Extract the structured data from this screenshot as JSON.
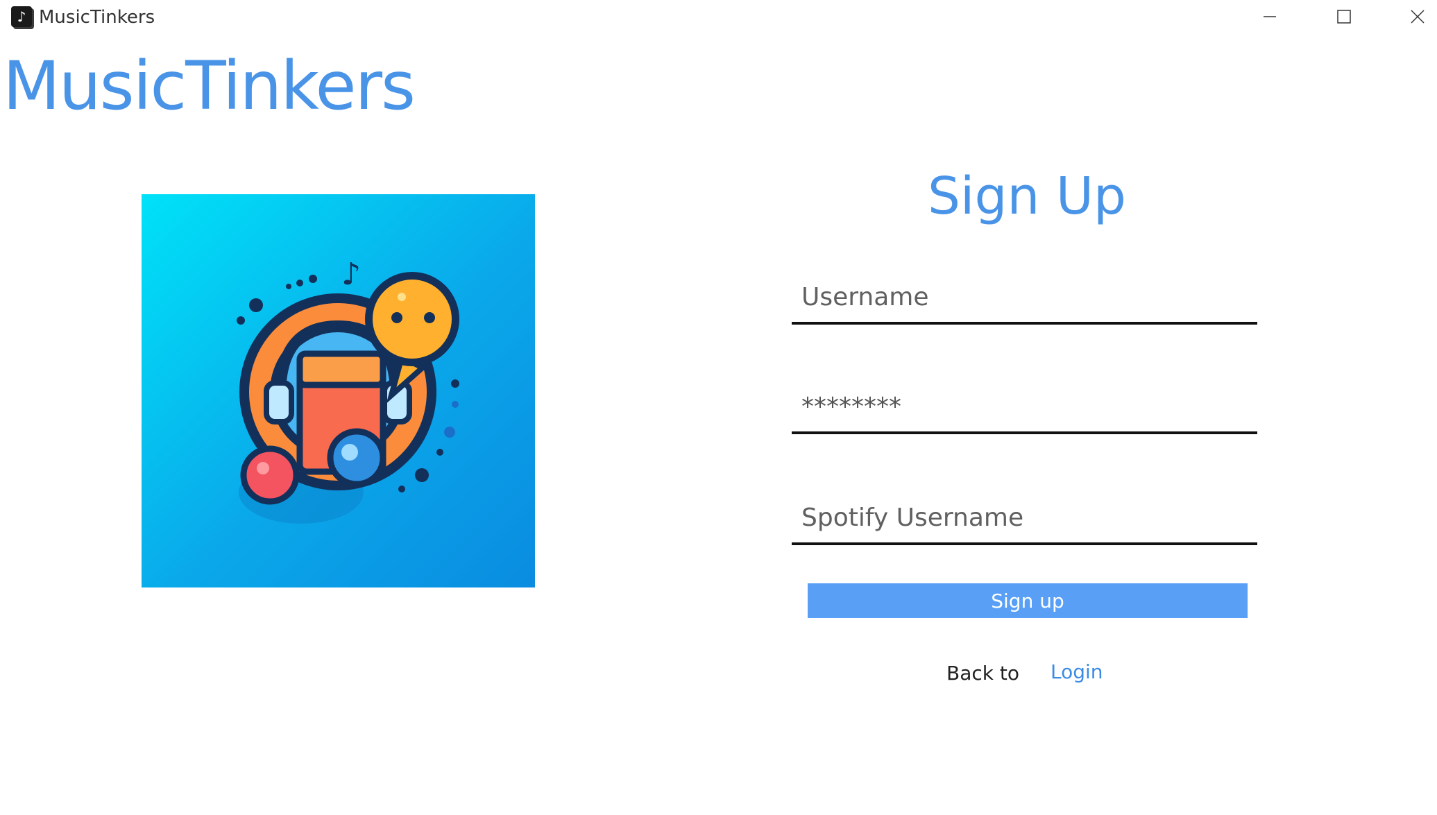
{
  "window": {
    "title": "MusicTinkers",
    "app_icon": "music-note-icon",
    "controls": [
      "minimize-icon",
      "maximize-icon",
      "close-icon"
    ]
  },
  "header": {
    "brand": "MusicTinkers"
  },
  "logo": {
    "icon": "music-chat-logo",
    "note_glyph": "♪"
  },
  "form": {
    "title": "Sign Up",
    "username_placeholder": "Username",
    "password_value": "********",
    "spotify_placeholder": "Spotify Username",
    "submit_label": "Sign up",
    "back_text": "Back to",
    "login_link": "Login"
  },
  "colors": {
    "accent": "#4a94e8",
    "button": "#589ff5",
    "logo_bg_top": "#00e2f8",
    "logo_bg_bottom": "#0a8ce0"
  }
}
